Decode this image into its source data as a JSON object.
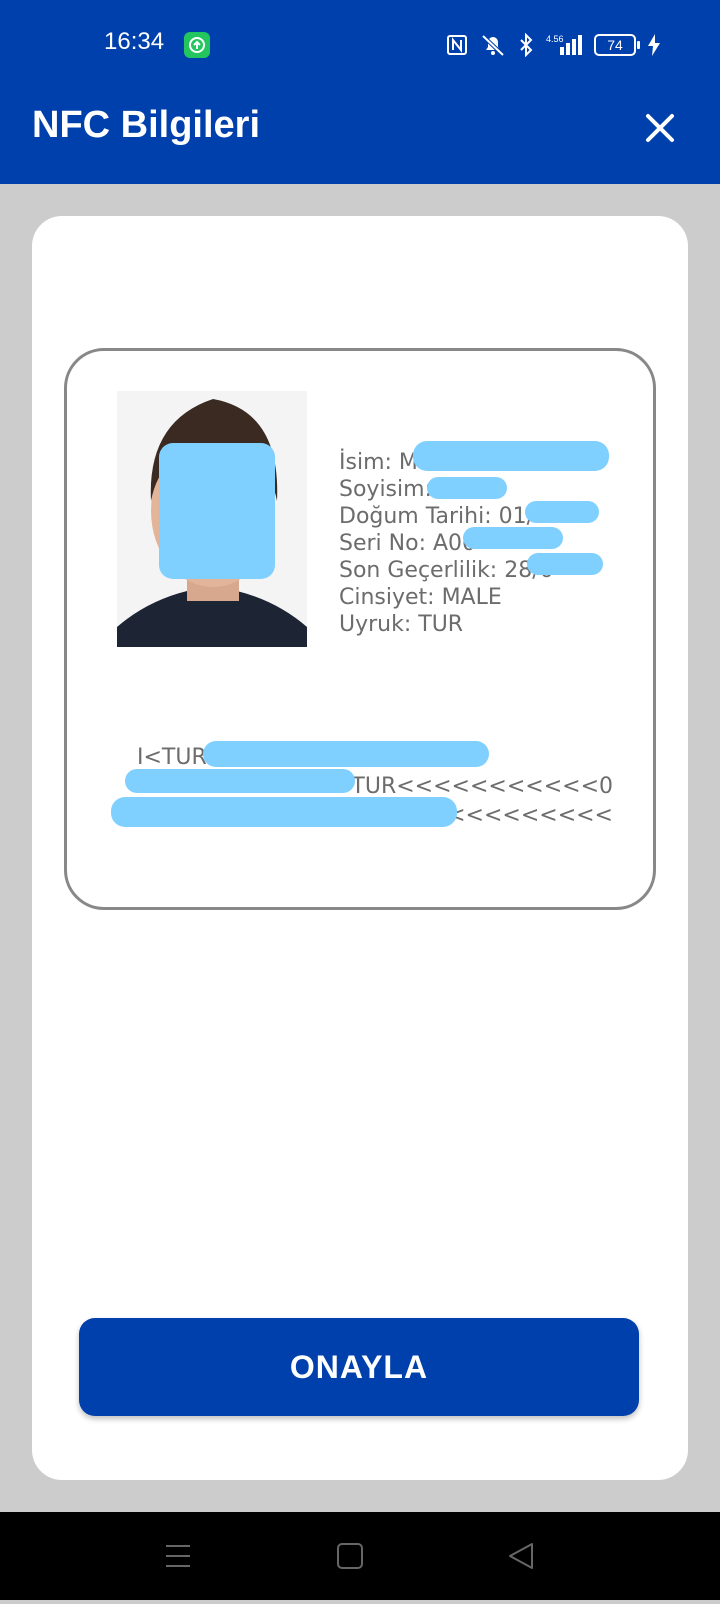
{
  "status_bar": {
    "time": "16:34",
    "battery": "74",
    "network": "4.56"
  },
  "header": {
    "title": "NFC Bilgileri"
  },
  "id_card": {
    "fields": [
      "İsim: M",
      "Soyisim:",
      "Doğum Tarihi: 01/",
      "Seri No: A00",
      "Son Geçerlilik: 28/0",
      "Cinsiyet: MALE",
      "Uyruk: TUR"
    ],
    "mrz": [
      "I<TUR",
      "TUR<<<<<<<<<<<0",
      "<<<<<<<<<<"
    ]
  },
  "actions": {
    "confirm": "ONAYLA"
  }
}
